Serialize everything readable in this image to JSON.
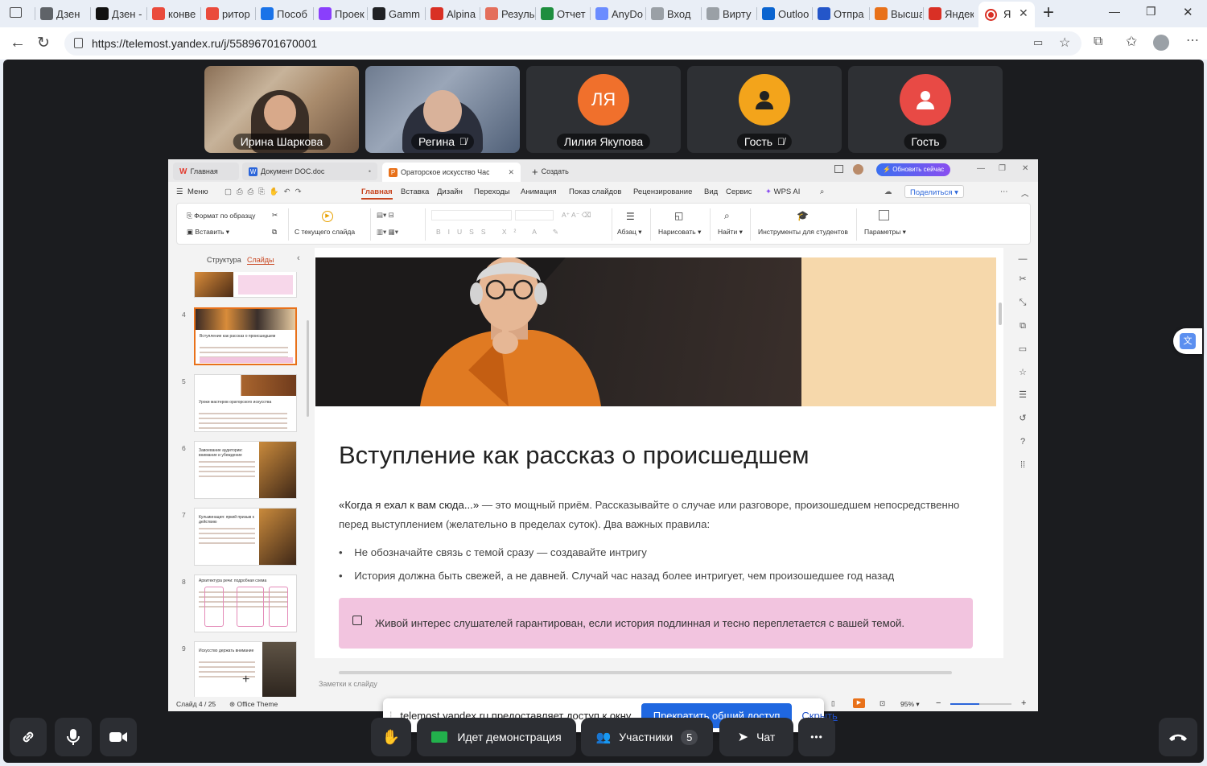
{
  "browser": {
    "tabs": [
      {
        "label": "Дзен",
        "color": "#5f6368"
      },
      {
        "label": "Дзен -",
        "color": "#111111"
      },
      {
        "label": "конве",
        "color": "#ea4b3c"
      },
      {
        "label": "ритор",
        "color": "#ea4b3c"
      },
      {
        "label": "Пособ",
        "color": "#1a73e8"
      },
      {
        "label": "Проек",
        "color": "#8a3ffc"
      },
      {
        "label": "Gamm",
        "color": "#202124"
      },
      {
        "label": "Alpina",
        "color": "#d93025"
      },
      {
        "label": "Резуль",
        "color": "#e46f5c"
      },
      {
        "label": "Отчет",
        "color": "#1e8e3e"
      },
      {
        "label": "AnyDo",
        "color": "#6b8cff"
      },
      {
        "label": "Вход",
        "color": "#9aa0a6"
      },
      {
        "label": "Вирту",
        "color": "#9aa0a6"
      },
      {
        "label": "Outloo",
        "color": "#0a64d0"
      },
      {
        "label": "Отпра",
        "color": "#2456c9"
      },
      {
        "label": "Высша",
        "color": "#e8711a"
      },
      {
        "label": "Яндек",
        "color": "#d93025"
      }
    ],
    "active_tab_label": "Я",
    "new_tab_symbol": "+",
    "url": "https://telemost.yandex.ru/j/55896701670001",
    "window_controls": {
      "minimize": "—",
      "maximize": "❐",
      "close": "✕"
    }
  },
  "participants": [
    {
      "name": "Ирина Шаркова",
      "type": "video",
      "muted": false
    },
    {
      "name": "Регина",
      "type": "video",
      "muted": true
    },
    {
      "name": "Лилия Якупова",
      "type": "initials",
      "initials": "ЛЯ",
      "color": "#f0702c",
      "muted": false
    },
    {
      "name": "Гость",
      "type": "icon",
      "color": "#f3a41b",
      "muted": true
    },
    {
      "name": "Гость",
      "type": "icon",
      "color": "#e84a45",
      "muted": false
    }
  ],
  "wps": {
    "tabs": [
      {
        "label": "Главная"
      },
      {
        "label": "Документ DOC.doc"
      },
      {
        "label": "Ораторское искусство Час"
      },
      {
        "label": "Создать"
      }
    ],
    "update_button": "Обновить сейчас",
    "share_button": "Поделиться",
    "menu": [
      "Меню",
      "Главная",
      "Вставка",
      "Дизайн",
      "Переходы",
      "Анимация",
      "Показ слайдов",
      "Рецензирование",
      "Вид",
      "Сервис",
      "WPS AI"
    ],
    "ribbon": {
      "format_painter": "Формат по образцу",
      "paste": "Вставить",
      "from_current": "С текущего слайда",
      "paragraph": "Абзац",
      "draw": "Нарисовать",
      "find": "Найти",
      "student_tools": "Инструменты для студентов",
      "parameters": "Параметры"
    },
    "panel_tabs": [
      "Структура",
      "Слайды"
    ],
    "thumbnails": [
      {
        "num": "4",
        "title": "Вступление как рассказ о происшедшем"
      },
      {
        "num": "5",
        "title": "Уроки мастеров ораторского искусства"
      },
      {
        "num": "6",
        "title": "Завоевание аудитории: внимание и убеждение"
      },
      {
        "num": "7",
        "title": "Кульминация: яркий призыв к действию"
      },
      {
        "num": "8",
        "title": "Архитектура речи: подробная схема"
      },
      {
        "num": "9",
        "title": "Искусство держать внимание"
      }
    ],
    "add_slide": "+",
    "slide": {
      "title": "Вступление как рассказ о происшедшем",
      "intro_quote": "«Когда я ехал к вам сюда...»",
      "intro_rest": " — это мощный приём. Рассказывайте о случае или разговоре, произошедшем непосредственно перед выступлением (желательно в пределах суток). Два важных правила:",
      "bullets": [
        "Не обозначайте связь с темой сразу — создавайте интригу",
        "История должна быть свежей, а не давней. Случай час назад более интригует, чем произошедшее год назад"
      ],
      "callout": "Живой интерес слушателей гарантирован, если история подлинная и тесно переплетается с вашей темой.",
      "accent_color": "#f2c4df"
    },
    "notes_placeholder": "Заметки к слайду",
    "status": {
      "slide_counter": "Слайд 4 / 25",
      "theme": "Office Theme",
      "zoom": "95%"
    }
  },
  "share_banner": {
    "text": "telemost.yandex.ru предоставляет доступ к окну.",
    "stop_button": "Прекратить общий доступ",
    "hide_link": "Скрыть"
  },
  "controls": {
    "demo_label": "Идет демонстрация",
    "participants_label": "Участники",
    "participants_count": "5",
    "chat_label": "Чат",
    "more_label": "•••"
  }
}
